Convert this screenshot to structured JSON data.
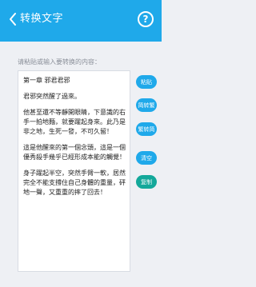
{
  "header": {
    "title": "转换文字",
    "help_symbol": "?"
  },
  "input": {
    "prompt": "请粘贴或输入要转换的内容：",
    "paragraphs": [
      "第一章 邪君君邪",
      "君邪突然醒了過來。",
      "他甚至還不等靜開眼睛，下意識的右手一拍地麵，就要躍起身來。此乃是非之地，生死一發，不可久留！",
      "這是他醒來的第一個念頭，這是一個優秀殺手幾乎已經形成本能的觸覺！",
      "身子躍起半空，突然手臂一軟，居然完全不能支撐住自己身體的重量，砰地一聲，又重重的摔了回去！"
    ]
  },
  "actions": {
    "paste": "粘贴",
    "to_traditional": "简转繁",
    "to_simplified": "繁转简",
    "clear": "清空",
    "copy": "复制"
  },
  "colors": {
    "accent": "#1fa9ea",
    "copy_button": "#13a89a",
    "background": "#eef0f4"
  }
}
